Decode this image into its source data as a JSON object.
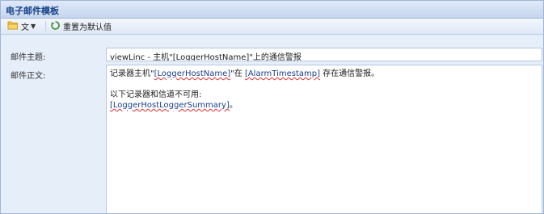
{
  "window": {
    "title": "电子邮件模板"
  },
  "toolbar": {
    "file_label": "文",
    "reset_label": "重置为默认值"
  },
  "form": {
    "subject_label": "邮件主题:",
    "body_label": "邮件正文:",
    "subject_value": "viewLinc - 主机\"[LoggerHostName]\"上的通信警报",
    "body": {
      "line1_prefix": "记录器主机\"",
      "line1_token1": "[LoggerHostName]",
      "line1_mid": "\"在 ",
      "line1_token2": "[AlarmTimestamp]",
      "line1_suffix": " 存在通信警报。",
      "line2": "以下记录器和信道不可用:",
      "line3_token": "[LoggerHostLoggerSummary]",
      "line3_suffix": "。"
    }
  },
  "icons": {
    "folder": "folder-icon",
    "reset": "reset-icon",
    "caret": "chevron-down-icon"
  },
  "colors": {
    "header_text": "#15428b",
    "form_bg": "#e6eef9",
    "border": "#9fb6d6",
    "token_text": "#1a3f8f",
    "token_underline": "#e03030"
  }
}
